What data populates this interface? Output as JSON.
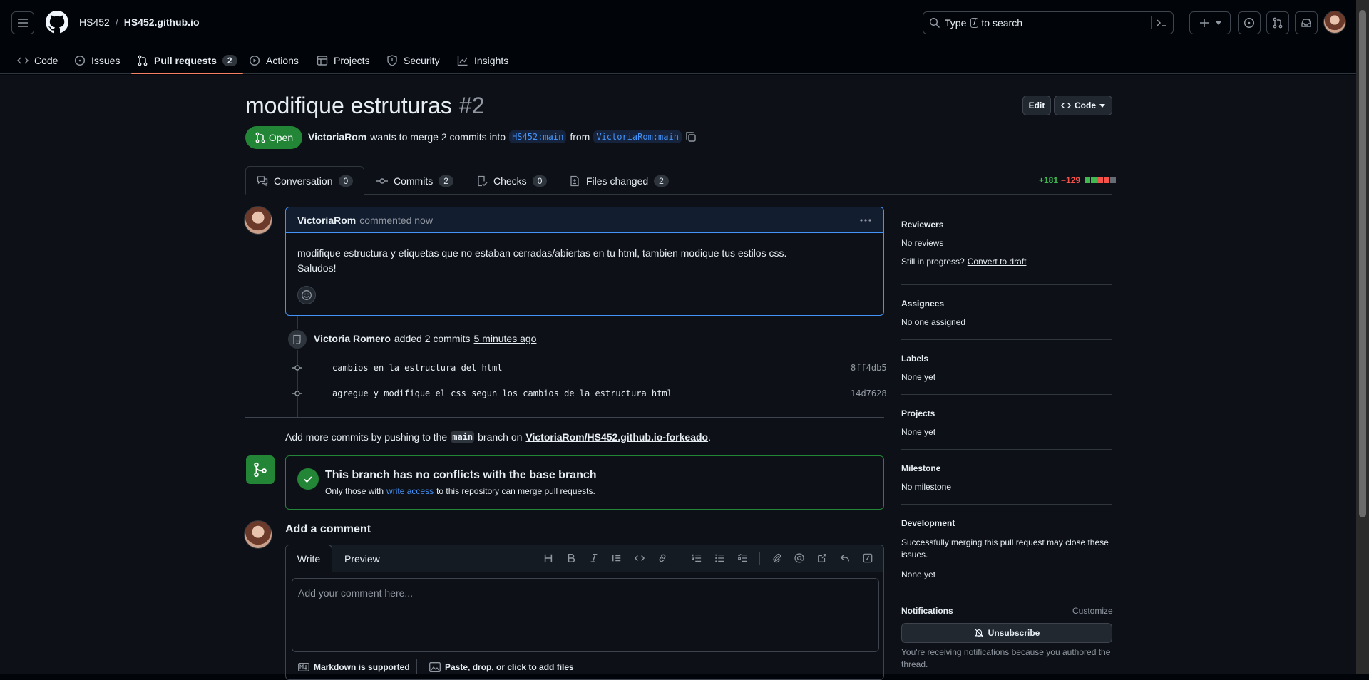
{
  "header": {
    "owner": "HS452",
    "separator": "/",
    "repo": "HS452.github.io",
    "search_placeholder": "Type / to search",
    "search_pre": "Type",
    "search_key": "/",
    "search_post": "to search"
  },
  "repo_nav": [
    {
      "label": "Code",
      "icon": "code-icon"
    },
    {
      "label": "Issues",
      "icon": "issue-opened-icon"
    },
    {
      "label": "Pull requests",
      "icon": "git-pull-request-icon",
      "count": "2",
      "selected": true
    },
    {
      "label": "Actions",
      "icon": "play-icon"
    },
    {
      "label": "Projects",
      "icon": "table-icon"
    },
    {
      "label": "Security",
      "icon": "shield-icon"
    },
    {
      "label": "Insights",
      "icon": "graph-icon"
    }
  ],
  "pr": {
    "title": "modifique estruturas",
    "number": "#2",
    "state": "Open",
    "author": "VictoriaRom",
    "merge_text": "wants to merge 2 commits into",
    "base_branch": "HS452:main",
    "from_text": "from",
    "head_branch": "VictoriaRom:main",
    "edit_label": "Edit",
    "code_label": "Code"
  },
  "tabs": [
    {
      "label": "Conversation",
      "count": "0"
    },
    {
      "label": "Commits",
      "count": "2"
    },
    {
      "label": "Checks",
      "count": "0"
    },
    {
      "label": "Files changed",
      "count": "2"
    }
  ],
  "diffstat": {
    "additions": "+181",
    "deletions": "−129"
  },
  "comment": {
    "author": "VictoriaRom",
    "action": "commented now",
    "line1": "modifique estructura y etiquetas que no estaban cerradas/abiertas en tu html, tambien modique tus estilos css.",
    "line2": "Saludos!"
  },
  "timeline": {
    "author": "Victoria Romero",
    "action": "added 2 commits",
    "time": "5 minutes ago",
    "commits": [
      {
        "message": "cambios en la estructura del html",
        "sha": "8ff4db5"
      },
      {
        "message": "agregue y modifique el css segun los cambios de la estructura html",
        "sha": "14d7628"
      }
    ]
  },
  "push_hint": {
    "pre": "Add more commits by pushing to the",
    "branch": "main",
    "mid": "branch on",
    "repo": "VictoriaRom/HS452.github.io-forkeado",
    "end": "."
  },
  "merge_box": {
    "title": "This branch has no conflicts with the base branch",
    "pre": "Only those with",
    "link": "write access",
    "post": "to this repository can merge pull requests."
  },
  "add_comment": {
    "heading": "Add a comment",
    "write_tab": "Write",
    "preview_tab": "Preview",
    "placeholder": "Add your comment here...",
    "markdown_note": "Markdown is supported",
    "attach_note": "Paste, drop, or click to add files"
  },
  "sidebar": {
    "reviewers_h": "Reviewers",
    "reviewers_v": "No reviews",
    "progress_pre": "Still in progress?",
    "progress_link": "Convert to draft",
    "assignees_h": "Assignees",
    "assignees_v": "No one assigned",
    "labels_h": "Labels",
    "labels_v": "None yet",
    "projects_h": "Projects",
    "projects_v": "None yet",
    "milestone_h": "Milestone",
    "milestone_v": "No milestone",
    "development_h": "Development",
    "development_desc": "Successfully merging this pull request may close these issues.",
    "development_v": "None yet",
    "notifications_h": "Notifications",
    "customize": "Customize",
    "unsubscribe": "Unsubscribe",
    "notif_reason": "You're receiving notifications because you authored the thread."
  },
  "colors": {
    "accent_green": "#238636",
    "link_blue": "#4493f8",
    "tab_underline": "#f78166"
  }
}
